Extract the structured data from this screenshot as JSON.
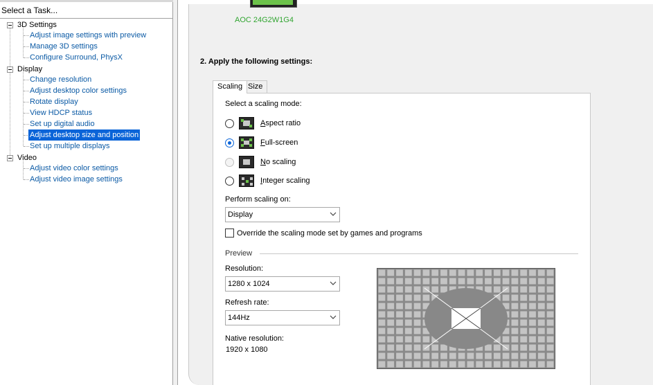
{
  "left_panel": {
    "header": "Select a Task...",
    "groups": [
      {
        "label": "3D Settings",
        "items": [
          {
            "label": "Adjust image settings with preview"
          },
          {
            "label": "Manage 3D settings"
          },
          {
            "label": "Configure Surround, PhysX"
          }
        ]
      },
      {
        "label": "Display",
        "items": [
          {
            "label": "Change resolution"
          },
          {
            "label": "Adjust desktop color settings"
          },
          {
            "label": "Rotate display"
          },
          {
            "label": "View HDCP status"
          },
          {
            "label": "Set up digital audio"
          },
          {
            "label": "Adjust desktop size and position",
            "selected": true
          },
          {
            "label": "Set up multiple displays"
          }
        ]
      },
      {
        "label": "Video",
        "items": [
          {
            "label": "Adjust video color settings"
          },
          {
            "label": "Adjust video image settings"
          }
        ]
      }
    ]
  },
  "main": {
    "monitor_label": "AOC 24G2W1G4",
    "section_title": "2. Apply the following settings:",
    "tabs": [
      {
        "label": "Scaling",
        "active": true
      },
      {
        "label": "Size",
        "active": false
      }
    ],
    "scaling": {
      "mode_prompt": "Select a scaling mode:",
      "modes": [
        {
          "label": "Aspect ratio",
          "mnemonic": "A",
          "rest": "spect ratio",
          "state": "unchecked"
        },
        {
          "label": "Full-screen",
          "mnemonic": "F",
          "rest": "ull-screen",
          "state": "checked"
        },
        {
          "label": "No scaling",
          "mnemonic": "N",
          "rest": "o scaling",
          "state": "disabled"
        },
        {
          "label": "Integer scaling",
          "mnemonic": "I",
          "rest": "nteger scaling",
          "state": "unchecked"
        }
      ],
      "perform_label": "Perform scaling on:",
      "perform_value": "Display",
      "override_label": "Override the scaling mode set by games and programs",
      "override_checked": false
    },
    "preview": {
      "title": "Preview",
      "resolution_label": "Resolution:",
      "resolution_value": "1280 x 1024",
      "refresh_label": "Refresh rate:",
      "refresh_value": "144Hz",
      "native_label": "Native resolution:",
      "native_value": "1920 x 1080"
    }
  },
  "colors": {
    "selection": "#0a64d8",
    "link": "#0b5aa5",
    "nvidia_green": "#6cc24a",
    "monitor_label": "#31a531"
  }
}
